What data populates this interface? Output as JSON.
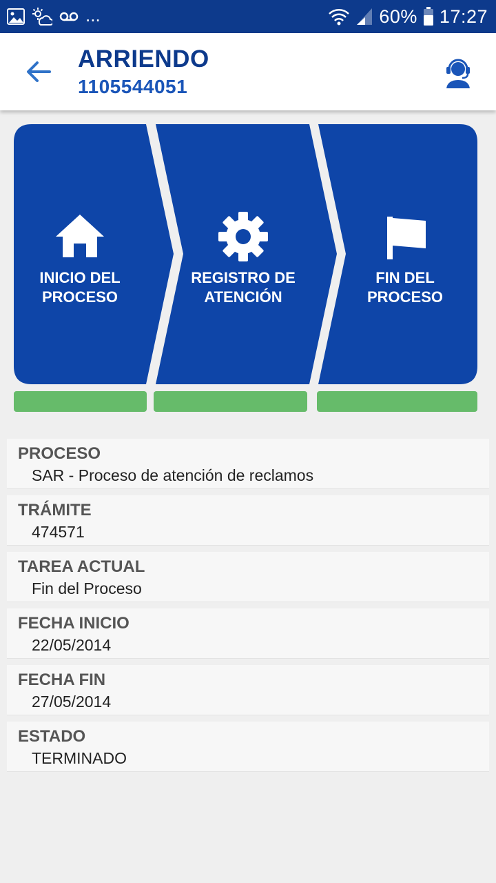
{
  "status_bar": {
    "battery": "60%",
    "time": "17:27",
    "overflow": "...",
    "icons": [
      "gallery-icon",
      "weather-icon",
      "voicemail-icon",
      "wifi-icon",
      "signal-icon",
      "battery-icon"
    ]
  },
  "header": {
    "title": "ARRIENDO",
    "subtitle": "1105544051",
    "back_icon": "arrow-left-icon",
    "support_icon": "support-agent-icon"
  },
  "colors": {
    "primary": "#0d3a8c",
    "panel": "#0e45a8",
    "progress": "#66bb6a",
    "background": "#efefef"
  },
  "steps": [
    {
      "icon": "home-icon",
      "line1": "INICIO DEL",
      "line2": "PROCESO",
      "progress": 1.0
    },
    {
      "icon": "gear-icon",
      "line1": "REGISTRO DE",
      "line2": "ATENCIÓN",
      "progress": 1.0
    },
    {
      "icon": "flag-icon",
      "line1": "FIN DEL",
      "line2": "PROCESO",
      "progress": 1.0
    }
  ],
  "details": [
    {
      "label": "PROCESO",
      "value": "SAR - Proceso de atención de reclamos"
    },
    {
      "label": "TRÁMITE",
      "value": "474571"
    },
    {
      "label": "TAREA ACTUAL",
      "value": "Fin del Proceso"
    },
    {
      "label": "FECHA INICIO",
      "value": "22/05/2014"
    },
    {
      "label": "FECHA FIN",
      "value": "27/05/2014"
    },
    {
      "label": "ESTADO",
      "value": "TERMINADO"
    }
  ]
}
